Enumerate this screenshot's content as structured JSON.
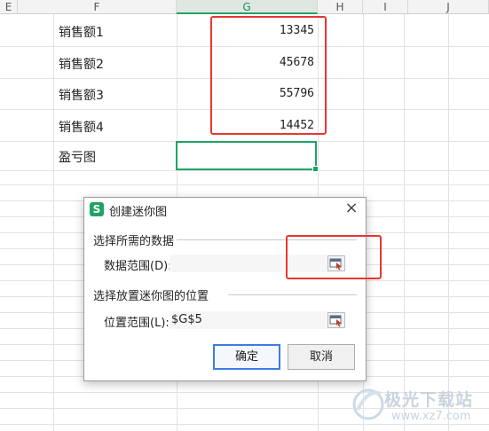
{
  "sheet": {
    "columns": [
      "E",
      "F",
      "G",
      "H",
      "I",
      "J"
    ],
    "selected_column": "G",
    "rows": [
      {
        "label": "销售额1",
        "value": "13345"
      },
      {
        "label": "销售额2",
        "value": "45678"
      },
      {
        "label": "销售额3",
        "value": "55796"
      },
      {
        "label": "销售额4",
        "value": "14452"
      },
      {
        "label": "盈亏图",
        "value": ""
      }
    ],
    "accent_color": "#21a366",
    "highlight_color": "#e8362f"
  },
  "dialog": {
    "title": "创建迷你图",
    "app_icon_letter": "S",
    "section1": "选择所需的数据",
    "data_range_label": "数据范围(D):",
    "data_range_value": "",
    "section2": "选择放置迷你图的位置",
    "location_label": "位置范围(L):",
    "location_value": "$G$5",
    "ok_label": "确定",
    "cancel_label": "取消"
  },
  "watermark": {
    "text": "极光下载站",
    "url": "www.xz7.com"
  }
}
